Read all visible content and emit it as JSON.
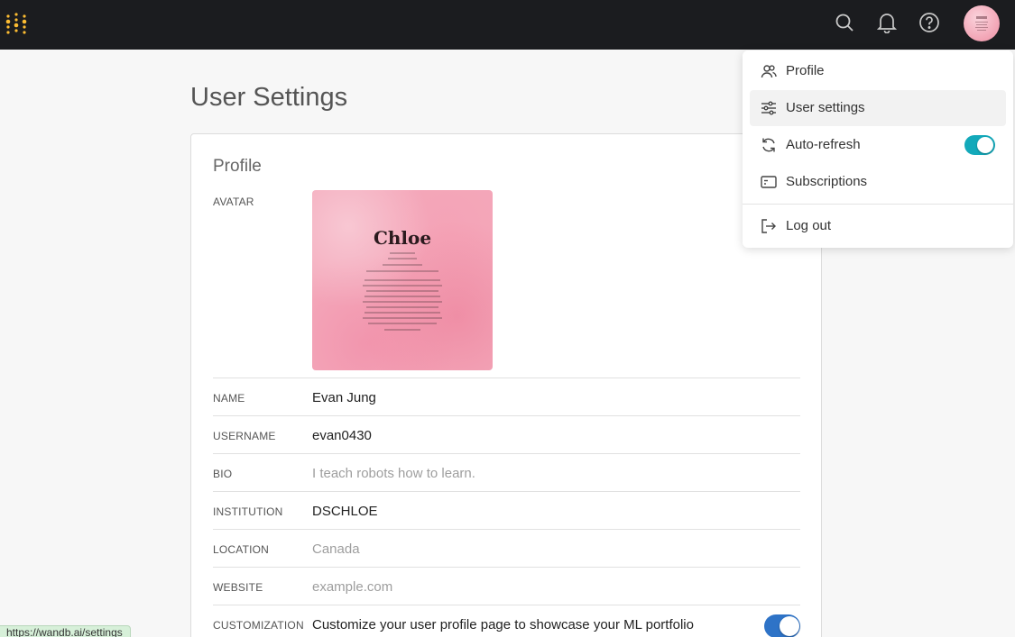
{
  "header": {
    "icons": [
      "wandb-logo-icon",
      "search-icon",
      "bell-icon",
      "help-icon"
    ],
    "avatar_alt": "user-avatar"
  },
  "page": {
    "title": "User Settings"
  },
  "profile": {
    "section_title": "Profile",
    "avatar_label": "AVATAR",
    "avatar_image_text": {
      "name": "Chloe"
    },
    "fields": [
      {
        "label": "NAME",
        "value": "Evan Jung",
        "placeholder": false
      },
      {
        "label": "USERNAME",
        "value": "evan0430",
        "placeholder": false
      },
      {
        "label": "BIO",
        "value": "I teach robots how to learn.",
        "placeholder": true
      },
      {
        "label": "INSTITUTION",
        "value": "DSCHLOE",
        "placeholder": false
      },
      {
        "label": "LOCATION",
        "value": "Canada",
        "placeholder": true
      },
      {
        "label": "WEBSITE",
        "value": "example.com",
        "placeholder": true
      },
      {
        "label": "CUSTOMIZATION",
        "value": "Customize your user profile page to showcase your ML portfolio",
        "placeholder": false
      }
    ],
    "customization_enabled": true
  },
  "menu": {
    "items": [
      {
        "label": "Profile",
        "icon": "users-icon"
      },
      {
        "label": "User settings",
        "icon": "sliders-icon"
      },
      {
        "label": "Auto-refresh",
        "icon": "refresh-icon",
        "toggle": true
      },
      {
        "label": "Subscriptions",
        "icon": "card-icon"
      },
      {
        "label": "Log out",
        "icon": "logout-icon"
      }
    ],
    "auto_refresh_enabled": true
  },
  "status_bar": {
    "url": "https://wandb.ai/settings"
  },
  "colors": {
    "topbar": "#1b1c1f",
    "logo": "#fcbc32",
    "toggle_teal": "#13a9ba",
    "toggle_blue": "#2e73c7"
  }
}
